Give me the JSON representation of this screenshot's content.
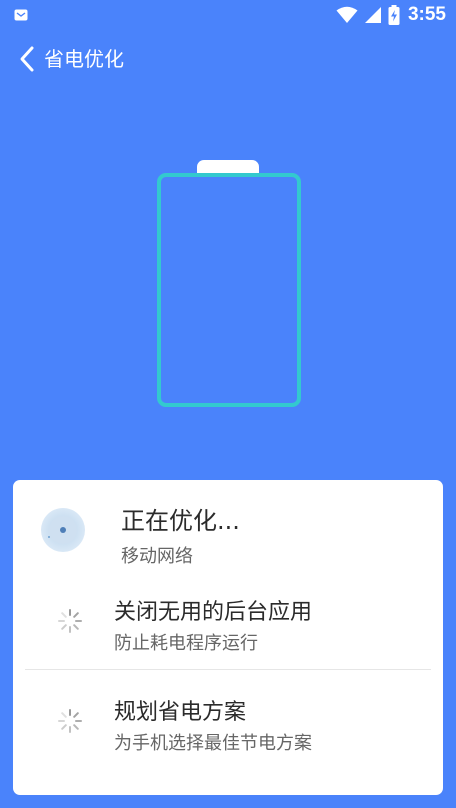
{
  "status_bar": {
    "time": "3:55",
    "icons": [
      "notification-icon",
      "wifi-icon",
      "cell-signal-icon",
      "battery-charging-icon"
    ]
  },
  "header": {
    "title": "省电优化",
    "back_icon": "chevron-left-icon"
  },
  "battery_graphic": {
    "cap_color": "#ffffff",
    "outline_color": "#33c9cf",
    "fill_level": 0
  },
  "card": {
    "status_title": "正在优化...",
    "status_subtitle": "移动网络",
    "tasks": [
      {
        "title": "关闭无用的后台应用",
        "description": "防止耗电程序运行",
        "icon": "loading-spinner-icon"
      },
      {
        "title": "规划省电方案",
        "description": "为手机选择最佳节电方案",
        "icon": "loading-spinner-icon"
      }
    ]
  },
  "colors": {
    "background": "#4a83fb",
    "card": "#ffffff",
    "accent": "#33c9cf"
  }
}
